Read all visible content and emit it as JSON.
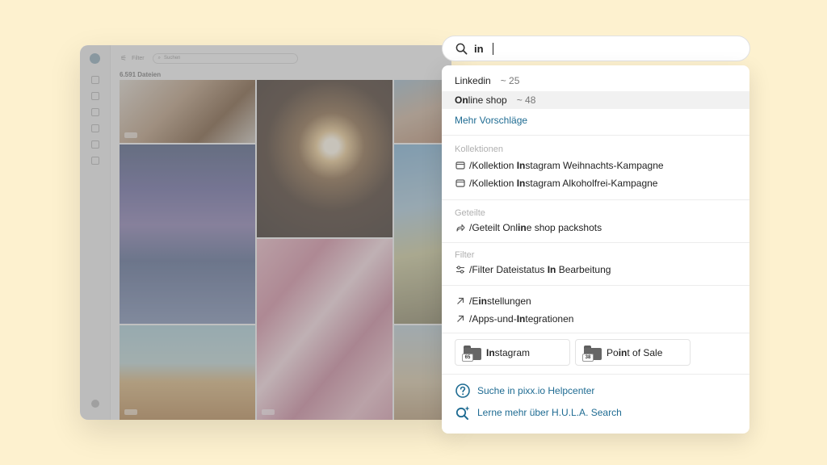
{
  "app": {
    "topbar": {
      "filter_label": "Filter",
      "search_placeholder": "Suchen"
    },
    "file_count": "6.591 Dateien"
  },
  "search": {
    "query": "in"
  },
  "suggestions": [
    {
      "label": "Linkedin",
      "count": "~ 25"
    },
    {
      "label_match": "On",
      "label_rest": "line shop",
      "count": "~ 48"
    }
  ],
  "more_suggestions": "Mehr Vorschläge",
  "sections": {
    "collections": {
      "label": "Kollektionen",
      "items": [
        {
          "pre": "/Kollektion ",
          "match": "In",
          "post": "stagram Weihnachts-Kampagne"
        },
        {
          "pre": "/Kollektion ",
          "match": "In",
          "post": "stagram Alkoholfrei-Kampagne"
        }
      ]
    },
    "shared": {
      "label": "Geteilte",
      "items": [
        {
          "pre": "/Geteilt Onl",
          "match": "in",
          "post": "e shop packshots"
        }
      ]
    },
    "filter": {
      "label": "Filter",
      "items": [
        {
          "pre": "/Filter Dateistatus ",
          "match": "In",
          "post": " Bearbeitung"
        }
      ]
    },
    "navigation": [
      {
        "pre": "/E",
        "match": "in",
        "post": "stellungen"
      },
      {
        "pre": "/Apps-und-",
        "match": "In",
        "post": "tegrationen"
      }
    ]
  },
  "chips": [
    {
      "badge": "65",
      "match": "In",
      "post": "stagram"
    },
    {
      "badge": "38",
      "pre": "Po",
      "match": "in",
      "post": "t of Sale"
    }
  ],
  "help": {
    "helpcenter": "Suche in pixx.io Helpcenter",
    "hula": "Lerne mehr über H.U.L.A. Search"
  }
}
